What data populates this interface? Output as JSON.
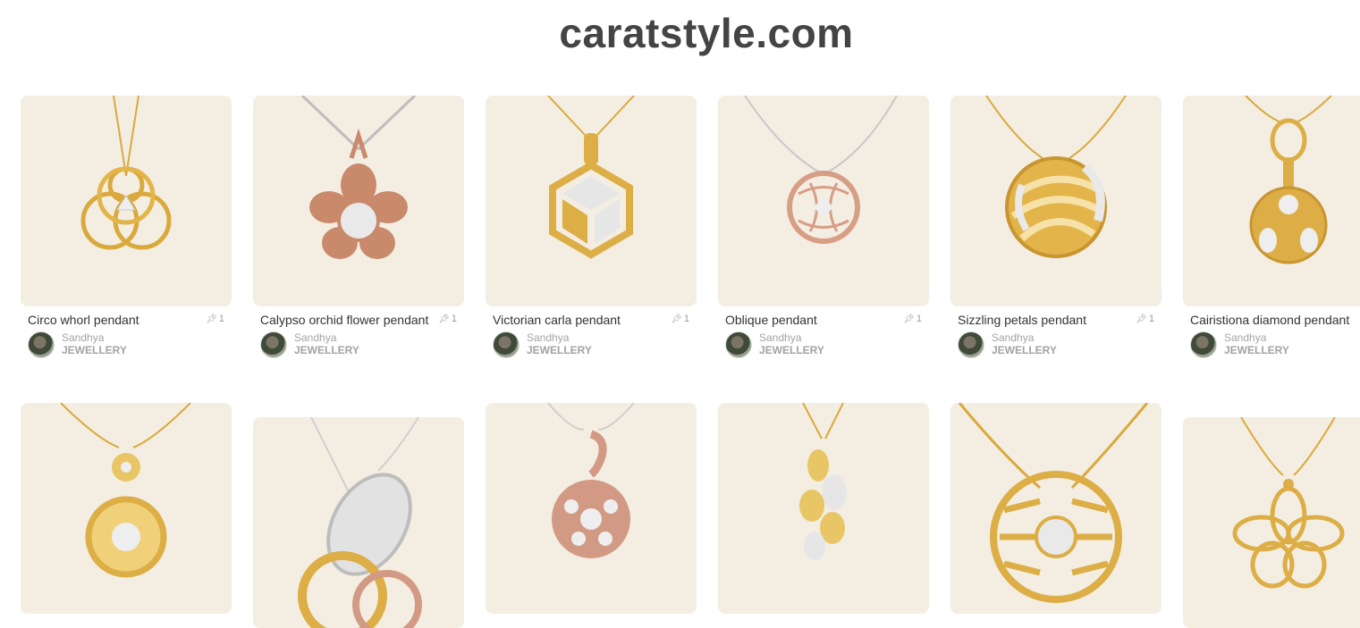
{
  "site": {
    "title": "caratstyle.com"
  },
  "pins_row1": [
    {
      "title": "Circo whorl pendant",
      "count": "1",
      "pinner": "Sandhya",
      "board": "JEWELLERY",
      "metal": "#d9a93c"
    },
    {
      "title": "Calypso orchid flower pendant",
      "count": "1",
      "pinner": "Sandhya",
      "board": "JEWELLERY",
      "metal": "#c98a6c"
    },
    {
      "title": "Victorian carla pendant",
      "count": "1",
      "pinner": "Sandhya",
      "board": "JEWELLERY",
      "metal": "#dcae45"
    },
    {
      "title": "Oblique pendant",
      "count": "1",
      "pinner": "Sandhya",
      "board": "JEWELLERY",
      "metal": "#d79e86"
    },
    {
      "title": "Sizzling petals pendant",
      "count": "1",
      "pinner": "Sandhya",
      "board": "JEWELLERY",
      "metal": "#dcae45"
    },
    {
      "title": "Cairistiona diamond pendant",
      "count": "",
      "pinner": "Sandhya",
      "board": "JEWELLERY",
      "metal": "#dcae45"
    }
  ],
  "pins_row2": [
    {
      "metal": "#dcae45"
    },
    {
      "metal": "#cfcfcf"
    },
    {
      "metal": "#d29a84"
    },
    {
      "metal": "#dcae45"
    },
    {
      "metal": "#dcae45"
    },
    {
      "metal": "#dcae45"
    }
  ]
}
